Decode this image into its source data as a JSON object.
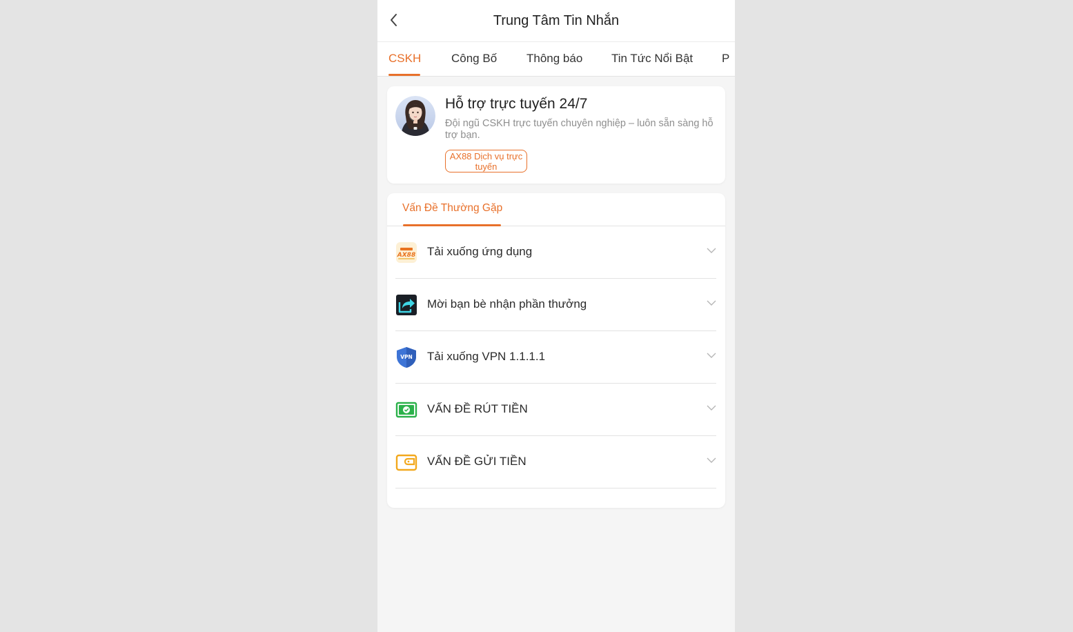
{
  "header": {
    "title": "Trung Tâm Tin Nhắn",
    "back_icon": "chevron-left-icon"
  },
  "tabs": [
    {
      "label": "CSKH",
      "active": true
    },
    {
      "label": "Công Bố",
      "active": false
    },
    {
      "label": "Thông báo",
      "active": false
    },
    {
      "label": "Tin Tức Nổi Bật",
      "active": false
    },
    {
      "label": "P",
      "active": false
    }
  ],
  "support": {
    "title": "Hỗ trợ trực tuyến 24/7",
    "description": "Đội ngũ CSKH trực tuyến chuyên nghiệp – luôn sẵn sàng hỗ trợ bạn.",
    "button_label": "AX88 Dịch vụ trực tuyến"
  },
  "faq": {
    "tab_label": "Vấn Đề Thường Gặp",
    "items": [
      {
        "label": "Tải xuống ứng dụng",
        "icon": "ax88-app-icon"
      },
      {
        "label": "Mời bạn bè nhận phần thưởng",
        "icon": "share-icon"
      },
      {
        "label": "Tải xuống VPN 1.1.1.1",
        "icon": "vpn-shield-icon"
      },
      {
        "label": "VẤN ĐỀ RÚT TIỀN",
        "icon": "cash-icon"
      },
      {
        "label": "VẤN ĐỀ GỬI TIỀN",
        "icon": "wallet-icon"
      }
    ]
  },
  "colors": {
    "accent": "#e8702a",
    "page_background": "#f5f5f5",
    "outer_background": "#e4e4e4"
  }
}
